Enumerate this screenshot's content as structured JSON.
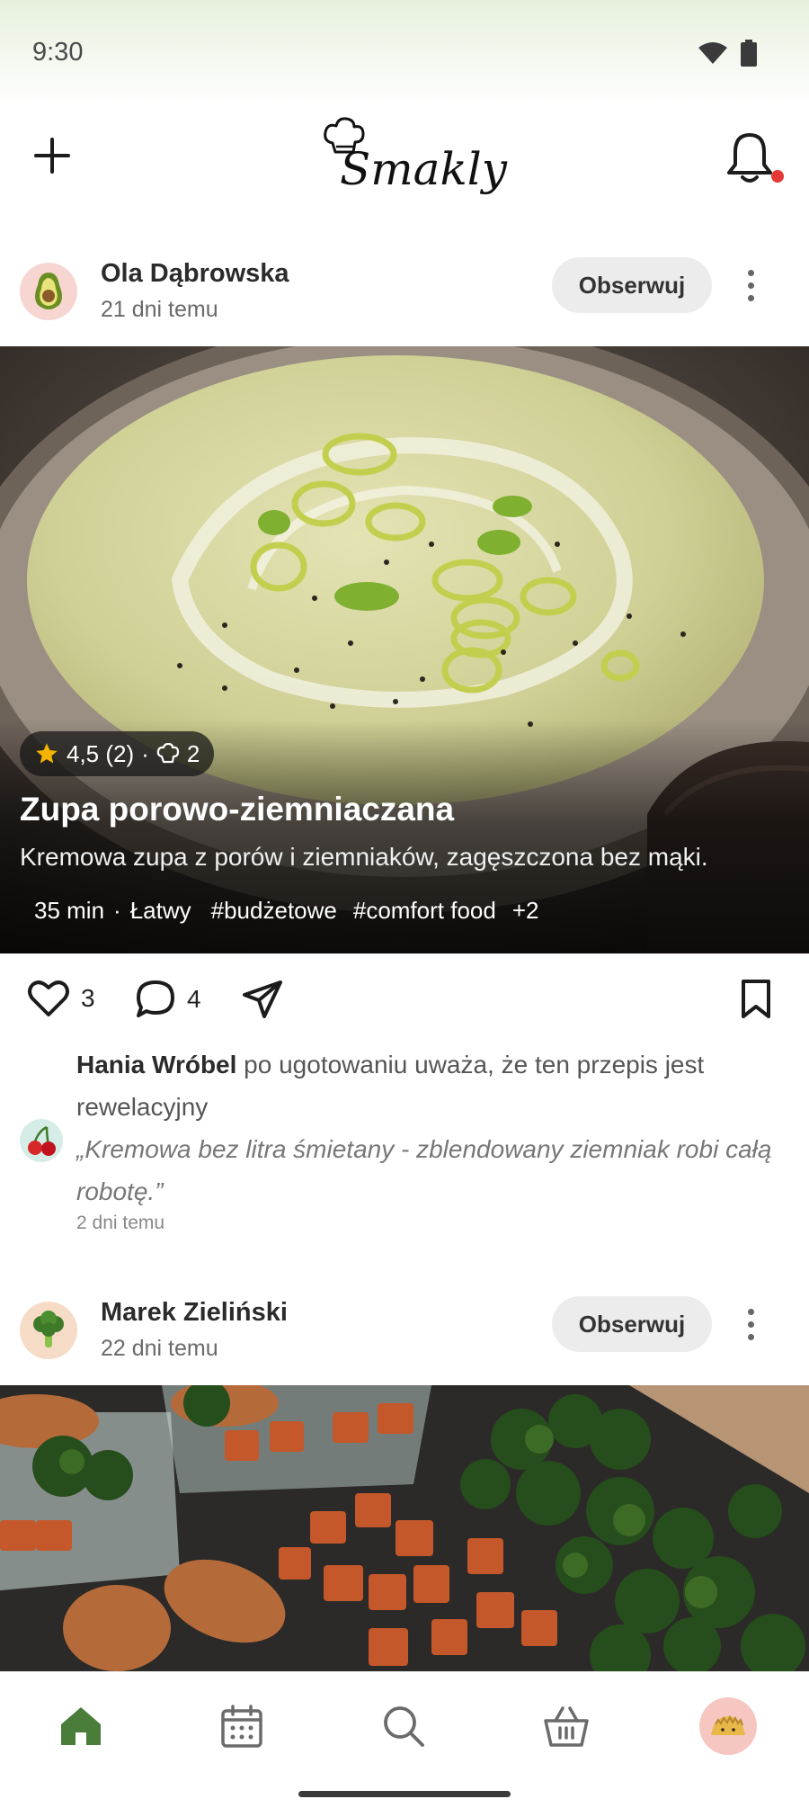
{
  "status_bar": {
    "time": "9:30"
  },
  "app": {
    "logo_text": "Smakly"
  },
  "posts": [
    {
      "author": "Ola Dąbrowska",
      "time": "21 dni temu",
      "avatar_icon": "avocado-icon",
      "follow_label": "Obserwuj",
      "rating": "4,5 (2)",
      "cooked_count": "2",
      "title": "Zupa porowo-ziemniaczana",
      "description": "Kremowa zupa z porów i ziemniaków, zagęszczona bez mąki.",
      "duration": "35 min",
      "difficulty": "Łatwy",
      "tags": [
        "#budżetowe",
        "#comfort food"
      ],
      "more_tags": "+2",
      "likes": "3",
      "comments": "4",
      "image": "leek-potato-soup-photo"
    },
    {
      "author": "Marek Zieliński",
      "time": "22 dni temu",
      "avatar_icon": "broccoli-icon",
      "follow_label": "Obserwuj",
      "image": "chicken-sweet-potato-broccoli-photo"
    }
  ],
  "activity": {
    "user": "Hania Wróbel",
    "action": " po ugotowaniu uważa, że ten przepis jest rewelacyjny",
    "quote": "„Kremowa bez litra śmietany - zblendowany ziemniak robi całą robotę.”",
    "time": "2 dni temu",
    "avatar_icon": "cherries-icon"
  },
  "nav": {
    "items": [
      "home-icon",
      "calendar-icon",
      "search-icon",
      "basket-icon",
      "profile-avatar"
    ],
    "active": "home-icon"
  },
  "colors": {
    "accent": "#4a7c3a",
    "notification": "#e53935",
    "follow_bg": "#ececec"
  }
}
